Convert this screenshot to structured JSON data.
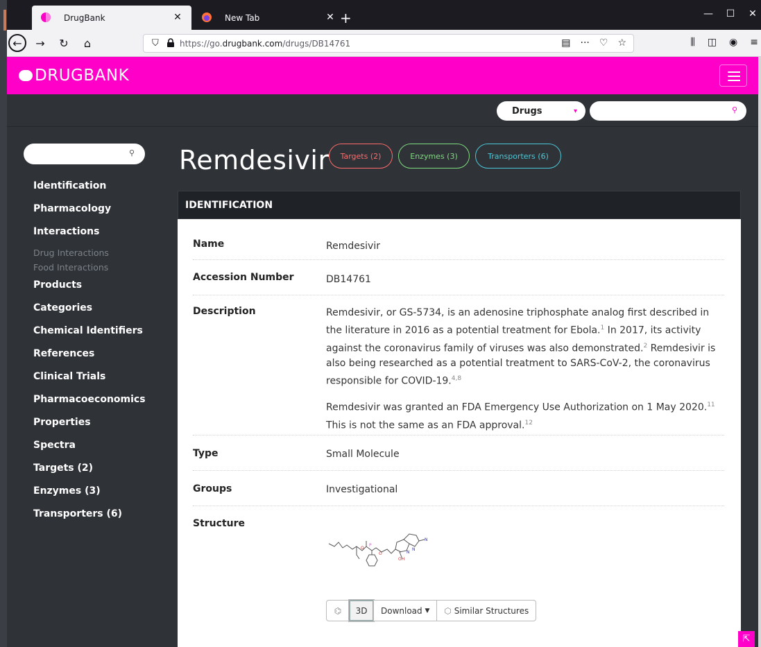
{
  "browser": {
    "tabs": [
      {
        "title": "DrugBank",
        "active": true
      },
      {
        "title": "New Tab",
        "active": false
      }
    ],
    "url_prefix": "https://go.",
    "url_domain": "drugbank.com",
    "url_path": "/drugs/DB14761"
  },
  "site": {
    "logo_text": "DRUGBANK",
    "search_category": "Drugs",
    "search_placeholder": "",
    "brand_color": "#ff00c8"
  },
  "sidebar": {
    "search_placeholder": "",
    "items": [
      {
        "label": "Identification",
        "sub": false
      },
      {
        "label": "Pharmacology",
        "sub": false
      },
      {
        "label": "Interactions",
        "sub": false
      },
      {
        "label": "Drug Interactions",
        "sub": true
      },
      {
        "label": "Food Interactions",
        "sub": true
      },
      {
        "label": "Products",
        "sub": false
      },
      {
        "label": "Categories",
        "sub": false
      },
      {
        "label": "Chemical Identifiers",
        "sub": false
      },
      {
        "label": "References",
        "sub": false
      },
      {
        "label": "Clinical Trials",
        "sub": false
      },
      {
        "label": "Pharmacoeconomics",
        "sub": false
      },
      {
        "label": "Properties",
        "sub": false
      },
      {
        "label": "Spectra",
        "sub": false
      },
      {
        "label": "Targets (2)",
        "sub": false
      },
      {
        "label": "Enzymes (3)",
        "sub": false
      },
      {
        "label": "Transporters (6)",
        "sub": false
      }
    ]
  },
  "main": {
    "title": "Remdesivir",
    "pills": {
      "targets": "Targets (2)",
      "enzymes": "Enzymes (3)",
      "transporters": "Transporters (6)"
    },
    "section_title": "IDENTIFICATION",
    "rows": {
      "name": {
        "label": "Name",
        "value": "Remdesivir"
      },
      "accession": {
        "label": "Accession Number",
        "value": "DB14761"
      },
      "description": {
        "label": "Description",
        "p1_a": "Remdesivir, or GS-5734, is an adenosine triphosphate analog first described in the literature in 2016 as a potential treatment for Ebola.",
        "p1_sup1": "1",
        "p1_b": " In 2017, its activity against the coronavirus family of viruses was also demonstrated.",
        "p1_sup2": "2",
        "p1_c": " Remdesivir is also being researched as a potential treatment to SARS-CoV-2, the coronavirus responsible for COVID-19.",
        "p1_sup3": "4,8",
        "p2_a": "Remdesivir was granted an FDA Emergency Use Authorization on 1 May 2020.",
        "p2_sup1": "11",
        "p2_b": " This is not the same as an FDA approval.",
        "p2_sup2": "12"
      },
      "type": {
        "label": "Type",
        "value": "Small Molecule"
      },
      "groups": {
        "label": "Groups",
        "value": "Investigational"
      },
      "structure": {
        "label": "Structure"
      }
    },
    "structure_tools": {
      "view_3d": "3D",
      "download": "Download",
      "similar": "Similar Structures"
    }
  }
}
